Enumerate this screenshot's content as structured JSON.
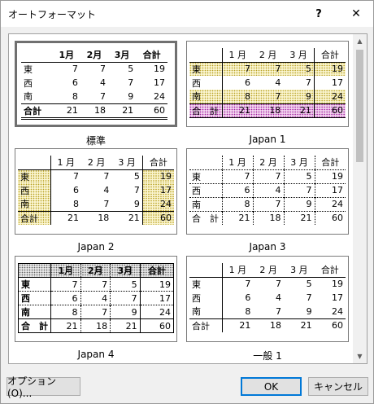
{
  "window": {
    "title": "オートフォーマット",
    "help": "?",
    "close": "✕"
  },
  "formats": [
    {
      "caption": "標準"
    },
    {
      "caption": "Japan 1"
    },
    {
      "caption": "Japan 2"
    },
    {
      "caption": "Japan 3"
    },
    {
      "caption": "Japan 4"
    },
    {
      "caption": "一般 1"
    }
  ],
  "sample": {
    "headers": [
      "1月",
      "2月",
      "3月",
      "合計"
    ],
    "headers_spaced": [
      "1 月",
      "2 月",
      "3 月",
      "合計"
    ],
    "rows": [
      {
        "label": "東",
        "values": [
          "7",
          "7",
          "5",
          "19"
        ]
      },
      {
        "label": "西",
        "values": [
          "6",
          "4",
          "7",
          "17"
        ]
      },
      {
        "label": "南",
        "values": [
          "8",
          "7",
          "9",
          "24"
        ]
      }
    ],
    "total": {
      "label": "合計",
      "label_spaced": "合　計",
      "values": [
        "21",
        "18",
        "21",
        "60"
      ]
    }
  },
  "buttons": {
    "options": "オプション(O)...",
    "ok": "OK",
    "cancel": "キャンセル"
  },
  "colors": {
    "accent": "#0078d7"
  }
}
